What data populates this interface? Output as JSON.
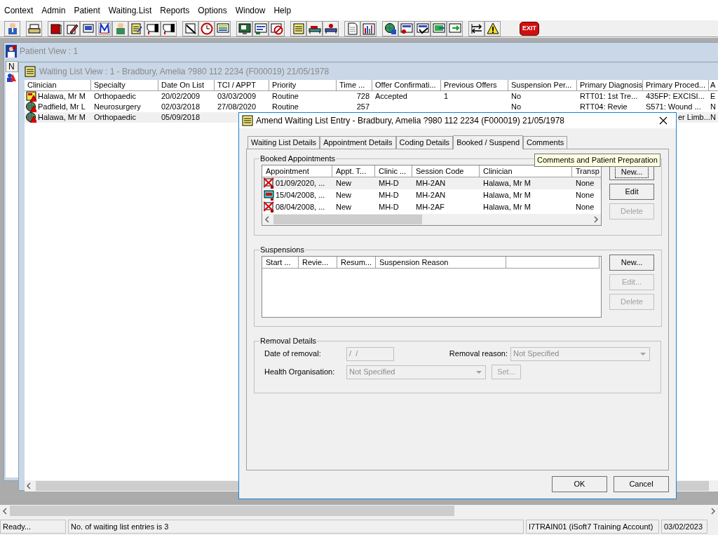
{
  "menu": [
    "Context",
    "Admin",
    "Patient",
    "Waiting.List",
    "Reports",
    "Options",
    "Window",
    "Help"
  ],
  "toolbar": {
    "exit_label": "EXIT"
  },
  "patient_view": {
    "title": "Patient View : 1",
    "column_header": "N"
  },
  "waiting_list_view": {
    "title": "Waiting List View :  1 - Bradbury, Amelia ?980 112 2234 (F000019) 21/05/1978",
    "columns": [
      "Clinician",
      "Specialty",
      "Date On List",
      "TCI / APPT",
      "Priority",
      "Time ...",
      "Offer Confirmati...",
      "Previous Offers",
      "Suspension Per...",
      "Primary Diagnosis",
      "Primary Proced...",
      "A"
    ],
    "rows": [
      {
        "kind": "note",
        "selected": false,
        "cells": [
          "Halawa, Mr M",
          "Orthopaedic",
          "20/02/2009",
          "03/03/2009",
          "Routine",
          "728",
          "Accepted",
          "1",
          "No",
          "RTT01: 1st Tre...",
          "435FP: EXCISI...",
          "E"
        ]
      },
      {
        "kind": "globe",
        "selected": false,
        "cells": [
          "Padfield, Mr L",
          "Neurosurgery",
          "02/03/2018",
          "27/08/2020",
          "Routine",
          "257",
          null,
          null,
          "No",
          "RTT04: Revie",
          "S571: Wound ...",
          "N"
        ]
      },
      {
        "kind": "globe",
        "selected": true,
        "cells": [
          "Halawa, Mr M",
          "Orthopaedic",
          "05/09/2018",
          null,
          null,
          null,
          null,
          null,
          null,
          null,
          "er Limb...",
          "N"
        ]
      }
    ]
  },
  "dialog": {
    "title": "Amend Waiting List Entry - Bradbury, Amelia ?980 112 2234 (F000019) 21/05/1978",
    "tabs": [
      {
        "label": "Waiting List Details",
        "selected": false
      },
      {
        "label": "Appointment Details",
        "selected": false
      },
      {
        "label": "Coding Details",
        "selected": false
      },
      {
        "label": "Booked / Suspend",
        "selected": true
      },
      {
        "label": "Comments",
        "selected": false
      }
    ],
    "tooltip": "Comments and Patient Preparation",
    "booked": {
      "title": "Booked Appointments",
      "columns": [
        "Appointment",
        "Appt. T...",
        "Clinic ...",
        "Session Code",
        "Clinician",
        "Transp"
      ],
      "rows": [
        {
          "kind": "cancelled",
          "selected": true,
          "cells": [
            "01/09/2020, ...",
            "New",
            "MH-D",
            "MH-2AN",
            "Halawa, Mr M",
            "None"
          ]
        },
        {
          "kind": "dna",
          "selected": false,
          "cells": [
            "15/04/2008, ...",
            "New",
            "MH-D",
            "MH-2AN",
            "Halawa, Mr M",
            "None"
          ]
        },
        {
          "kind": "cancelled",
          "selected": false,
          "cells": [
            "08/04/2008, ...",
            "New",
            "MH-D",
            "MH-2AF",
            "Halawa, Mr M",
            "None"
          ]
        }
      ],
      "buttons": [
        {
          "label": "New...",
          "disabled": false,
          "focused": true
        },
        {
          "label": "Edit",
          "disabled": false,
          "focused": false
        },
        {
          "label": "Delete",
          "disabled": true,
          "focused": false
        }
      ]
    },
    "suspensions": {
      "title": "Suspensions",
      "columns": [
        "Start ...",
        "Revie...",
        "Resum...",
        "Suspension Reason"
      ],
      "buttons": [
        {
          "label": "New...",
          "disabled": false,
          "focused": false
        },
        {
          "label": "Edit...",
          "disabled": true,
          "focused": false
        },
        {
          "label": "Delete",
          "disabled": true,
          "focused": false
        }
      ]
    },
    "removal": {
      "title": "Removal Details",
      "date_label": "Date of removal:",
      "date_value": "/  /",
      "date_disabled": true,
      "reason_label": "Removal reason:",
      "reason_value": "Not Specified",
      "reason_disabled": true,
      "org_label": "Health Organisation:",
      "org_value": "Not Specified",
      "org_disabled": true,
      "set_button": {
        "label": "Set...",
        "disabled": true
      }
    },
    "buttons": [
      "OK",
      "Cancel"
    ]
  },
  "status_bar": [
    "Ready...",
    "No. of waiting list entries is 3",
    "I7TRAIN01 (iSoft7 Training Account)",
    "03/02/2023"
  ]
}
